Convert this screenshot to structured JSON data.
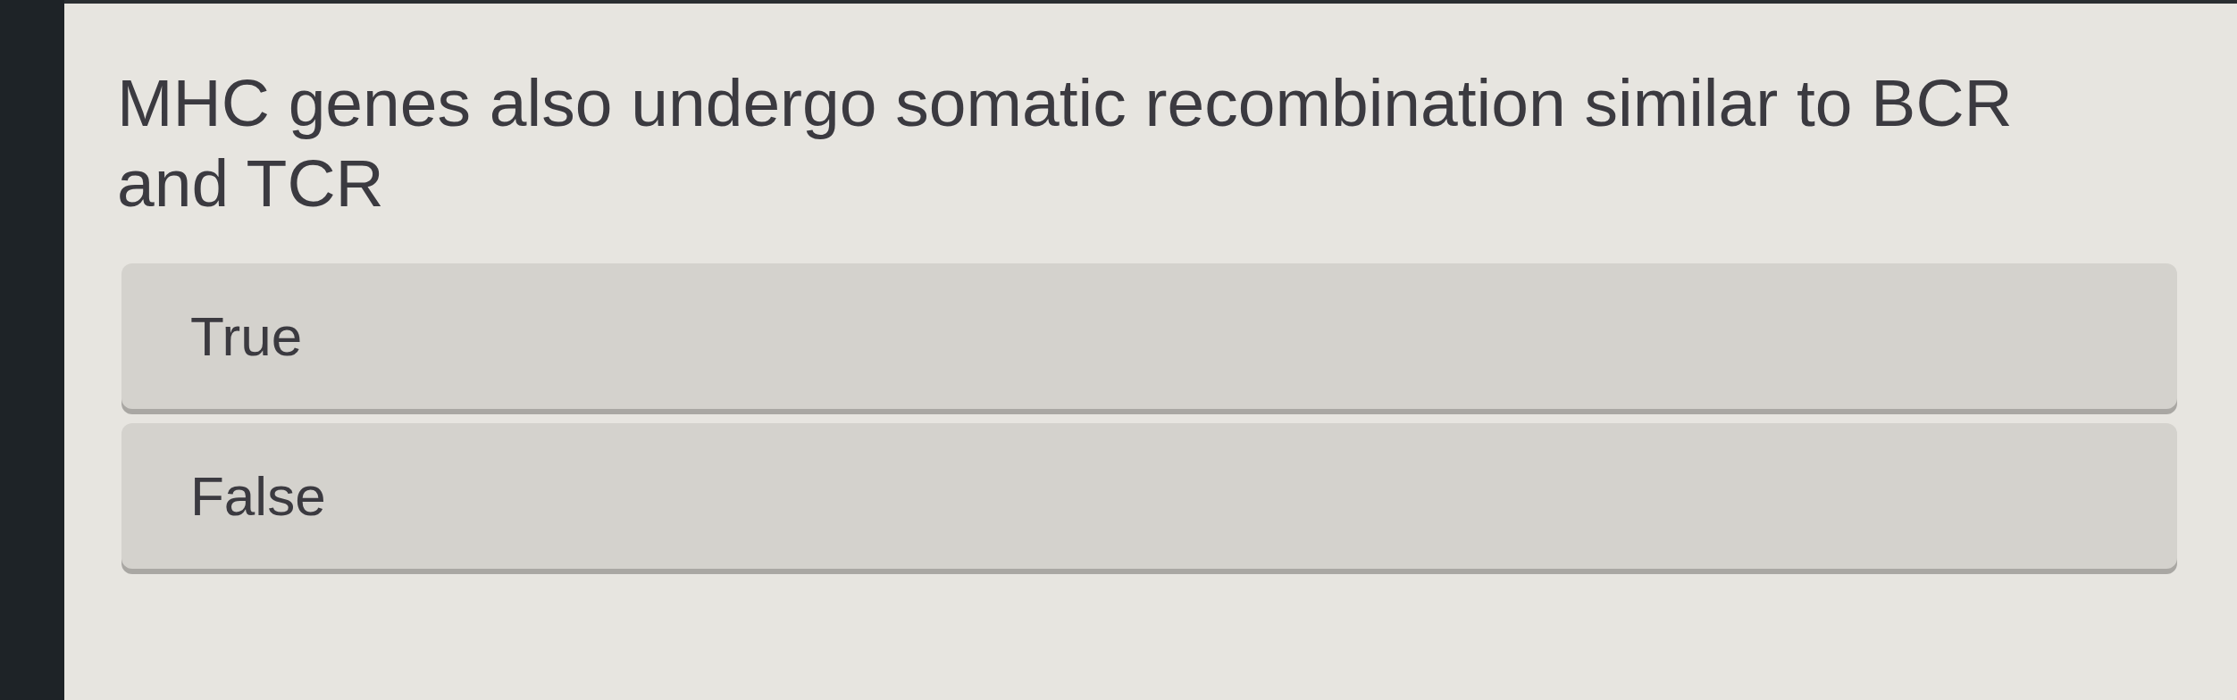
{
  "question": {
    "text": "MHC genes also undergo somatic recombination similar to BCR and TCR"
  },
  "options": [
    {
      "label": "True",
      "selected": false
    },
    {
      "label": "False",
      "selected": false
    }
  ]
}
